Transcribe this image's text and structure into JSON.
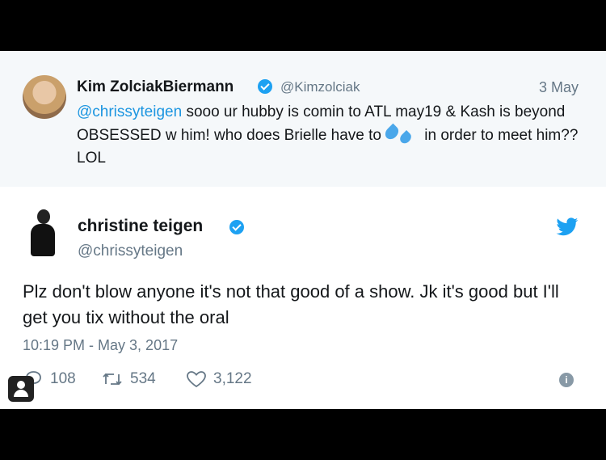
{
  "reply": {
    "author_name": "Kim ZolciakBiermann",
    "author_handle": "@Kimzolciak",
    "date": "3 May",
    "mention": "@chrissyteigen",
    "text_part1": " sooo ur hubby is comin to ATL may19 & Kash is beyond OBSESSED w him! who does Brielle have to",
    "emoji": "sweat-droplets-icon",
    "text_part2": " in order to meet him?? LOL"
  },
  "tweet": {
    "author_name": "christine teigen",
    "author_handle": "@chrissyteigen",
    "text": "Plz don't blow anyone it's not that good of a show. Jk it's good but I'll get you tix without the oral",
    "timestamp": "10:19 PM - May 3, 2017",
    "replies": "108",
    "retweets": "534",
    "likes": "3,122"
  },
  "colors": {
    "accent": "#1da1f2",
    "text": "#14171a",
    "muted": "#657786",
    "reply_bg": "#f5f8fa"
  }
}
